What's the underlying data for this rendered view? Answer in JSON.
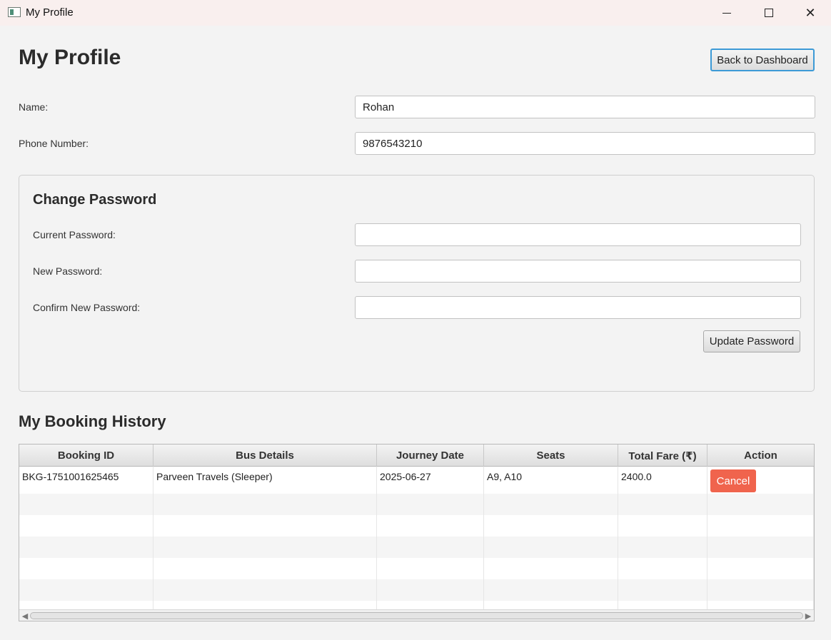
{
  "window": {
    "title": "My Profile"
  },
  "header": {
    "title": "My Profile",
    "back_button": "Back to Dashboard"
  },
  "profile": {
    "name_label": "Name:",
    "name_value": "Rohan",
    "phone_label": "Phone Number:",
    "phone_value": "9876543210"
  },
  "change_password": {
    "title": "Change Password",
    "current_label": "Current Password:",
    "current_value": "",
    "new_label": "New Password:",
    "new_value": "",
    "confirm_label": "Confirm New Password:",
    "confirm_value": "",
    "update_button": "Update Password"
  },
  "history": {
    "title": "My Booking History",
    "columns": [
      "Booking ID",
      "Bus Details",
      "Journey Date",
      "Seats",
      "Total Fare (₹)",
      "Action"
    ],
    "rows": [
      {
        "booking_id": "BKG-1751001625465",
        "bus_details": "Parveen Travels (Sleeper)",
        "journey_date": "2025-06-27",
        "seats": "A9, A10",
        "total_fare": "2400.0",
        "action": "Cancel"
      }
    ]
  },
  "colors": {
    "accent": "#3c9ad6",
    "cancel": "#f0644d"
  }
}
